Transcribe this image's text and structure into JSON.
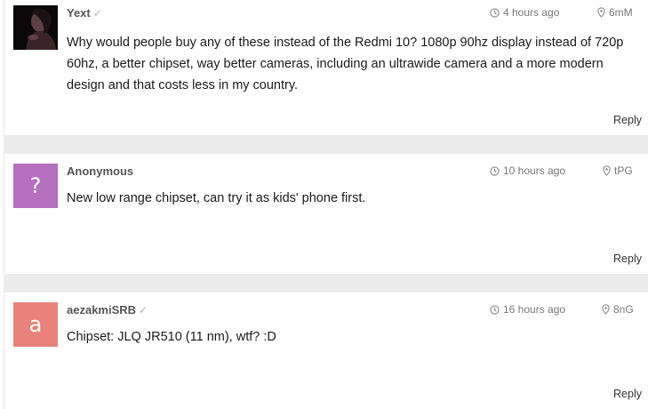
{
  "comments": [
    {
      "author": "Yext",
      "verified": true,
      "avatar_type": "photo",
      "time": "4 hours ago",
      "location": "6mM",
      "text": "Why would people buy any of these instead of the Redmi 10? 1080p 90hz display instead of 720p 60hz, a better chipset, way better cameras, including an ultrawide camera and a more modern design and that costs less in my country.",
      "reply": "Reply"
    },
    {
      "author": "Anonymous",
      "verified": false,
      "avatar_type": "letter",
      "avatar_letter": "?",
      "avatar_color": "#b46fbe",
      "time": "10 hours ago",
      "location": "tPG",
      "text": "New low range chipset, can try it as kids' phone first.",
      "reply": "Reply"
    },
    {
      "author": "aezakmiSRB",
      "verified": true,
      "avatar_type": "letter",
      "avatar_letter": "a",
      "avatar_color": "#e8827a",
      "time": "16 hours ago",
      "location": "8nG",
      "text": "Chipset: JLQ JR510 (11 nm), wtf? :D",
      "reply": "Reply"
    }
  ],
  "icons": {
    "clock": "clock-icon",
    "location": "location-pin-icon",
    "verified": "checkmark-icon"
  },
  "colors": {
    "separator": "#ececec",
    "meta_text": "#777777",
    "author_text": "#555555"
  }
}
